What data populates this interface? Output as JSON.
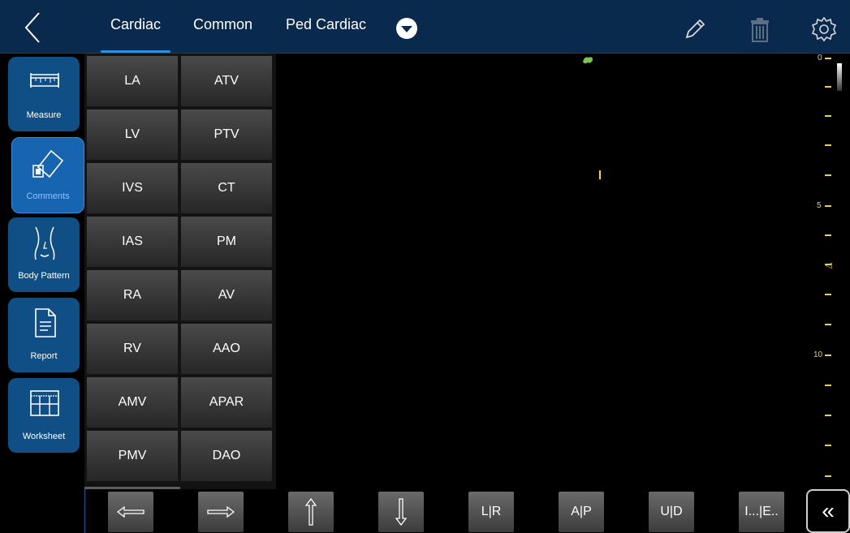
{
  "tabs": [
    {
      "label": "Cardiac",
      "active": true
    },
    {
      "label": "Common",
      "active": false
    },
    {
      "label": "Ped Cardiac",
      "active": false
    }
  ],
  "sidebar": [
    {
      "label": "Measure",
      "icon": "ruler-icon"
    },
    {
      "label": "Comments",
      "icon": "tag-icon",
      "active": true
    },
    {
      "label": "Body Pattern",
      "icon": "body-outline-icon"
    },
    {
      "label": "Report",
      "icon": "document-icon"
    },
    {
      "label": "Worksheet",
      "icon": "table-icon"
    }
  ],
  "comments": {
    "left": [
      "LA",
      "LV",
      "IVS",
      "IAS",
      "RA",
      "RV",
      "AMV",
      "PMV"
    ],
    "right": [
      "ATV",
      "PTV",
      "CT",
      "PM",
      "AV",
      "AAO",
      "APAR",
      "DAO"
    ]
  },
  "ruler": {
    "labels": [
      "0",
      "5",
      "10"
    ]
  },
  "bottom": {
    "buttons": [
      "",
      "",
      "",
      "",
      "L|R",
      "A|P",
      "U|D",
      "I...|E.."
    ],
    "icons": [
      "arrow-left-icon",
      "arrow-right-icon",
      "arrow-up-icon",
      "arrow-down-icon"
    ],
    "collapse_label": "«"
  },
  "colors": {
    "topbar": "#0a2a4d",
    "sidebar_item": "#0f4f86",
    "accent": "#2d8fe0",
    "ruler": "#e8d24a",
    "cursor": "#ffd800"
  }
}
